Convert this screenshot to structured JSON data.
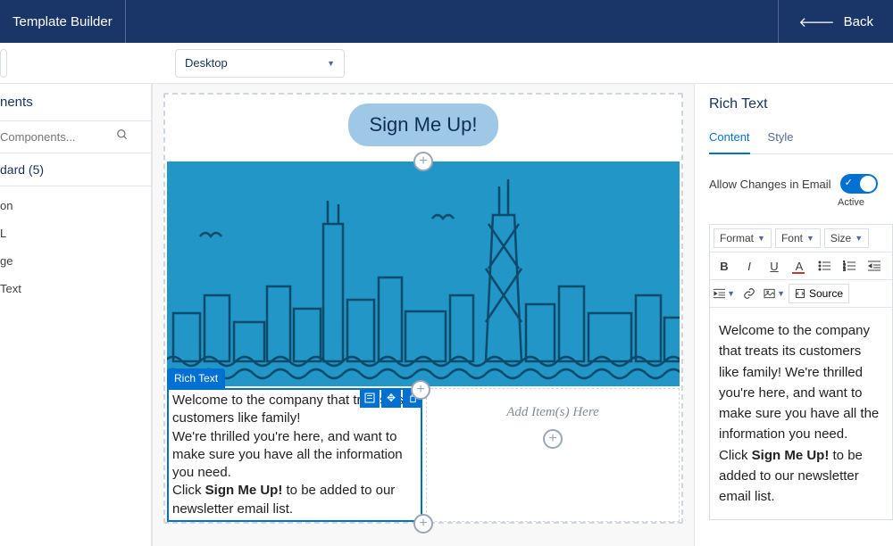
{
  "topbar": {
    "title": "Template Builder",
    "back": "Back"
  },
  "toolbar": {
    "viewport": "Desktop"
  },
  "sidebar": {
    "title": "nents",
    "search_placeholder": "Components...",
    "accordion": "dard (5)",
    "items": [
      "on",
      "L",
      "ge",
      "Text"
    ]
  },
  "canvas": {
    "cta": "Sign Me Up!",
    "selected_label": "Rich Text",
    "add_placeholder": "Add Item(s) Here",
    "rich_text": {
      "l1": "Welcome to the company that treats its customers like family!",
      "l2": "We're thrilled you're here, and want to make sure you have all the information you need.",
      "l3a": "Click ",
      "l3b": "Sign Me Up!",
      "l3c": " to be added to our newsletter email list."
    }
  },
  "panel": {
    "title": "Rich Text",
    "tabs": {
      "content": "Content",
      "style": "Style"
    },
    "toggle_label": "Allow Changes in Email",
    "toggle_state": "Active",
    "editor": {
      "format": "Format",
      "font": "Font",
      "size": "Size",
      "source": "Source",
      "preview": {
        "p1": "Welcome to the company that treats its customers like family! We're thrilled you're here, and want to make sure you have all the information you need.",
        "p2a": "Click ",
        "p2b": "Sign Me Up!",
        "p2c": " to be added to our newsletter email list."
      }
    }
  }
}
